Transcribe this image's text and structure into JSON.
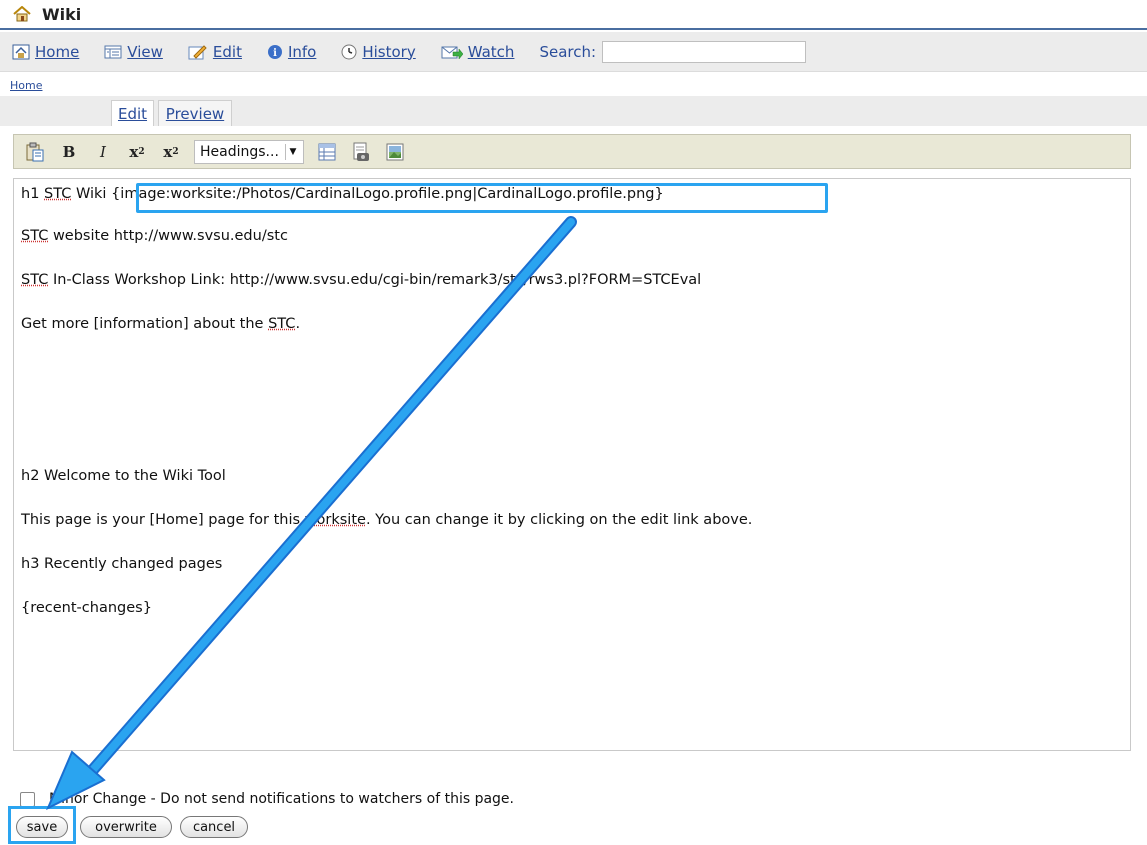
{
  "window": {
    "title": "Wiki"
  },
  "toolbar": {
    "home": "Home",
    "view": "View",
    "edit": "Edit",
    "info": "Info",
    "history": "History",
    "watch": "Watch",
    "search_label": "Search:",
    "search_value": ""
  },
  "breadcrumb": "Home",
  "tabs": [
    {
      "label": "Edit",
      "selected": true
    },
    {
      "label": "Preview",
      "selected": false
    }
  ],
  "editor_toolbar": {
    "bold": "B",
    "italic": "I",
    "superscript": "x",
    "subscript": "x",
    "headings": "Headings..."
  },
  "content": {
    "line1_prefix": "h1 ",
    "line1_stc": "STC",
    "line1_mid": " Wiki  ",
    "line1_image": "{image:worksite:/Photos/CardinalLogo.profile.png|CardinalLogo.profile.png}",
    "line2_stc": "STC",
    "line2_rest": " website http://www.svsu.edu/stc",
    "line3_stc": "STC",
    "line3_rest": " In-Class Workshop Link: http://www.svsu.edu/cgi-bin/remark3/stc/rws3.pl?FORM=STCEval",
    "line4_prefix": "Get more [information] about the ",
    "line4_stc": "STC",
    "line4_suffix": ".",
    "line5": "h2 Welcome to the Wiki Tool",
    "line6_prefix": "This page is your [Home] page for this ",
    "line6_worksite": "worksite",
    "line6_suffix": ". You can change it by clicking on the edit link above.",
    "line7": "h3 Recently changed pages",
    "line8": "{recent-changes}"
  },
  "minor_change": {
    "checked": false,
    "label": "Minor Change - Do not send notifications to watchers of this page."
  },
  "buttons": {
    "save": "save",
    "overwrite": "overwrite",
    "cancel": "cancel"
  },
  "colors": {
    "link": "#2a4d9a",
    "highlight": "#2aa4f0",
    "editor_toolbar_bg": "#e9e8d6"
  }
}
